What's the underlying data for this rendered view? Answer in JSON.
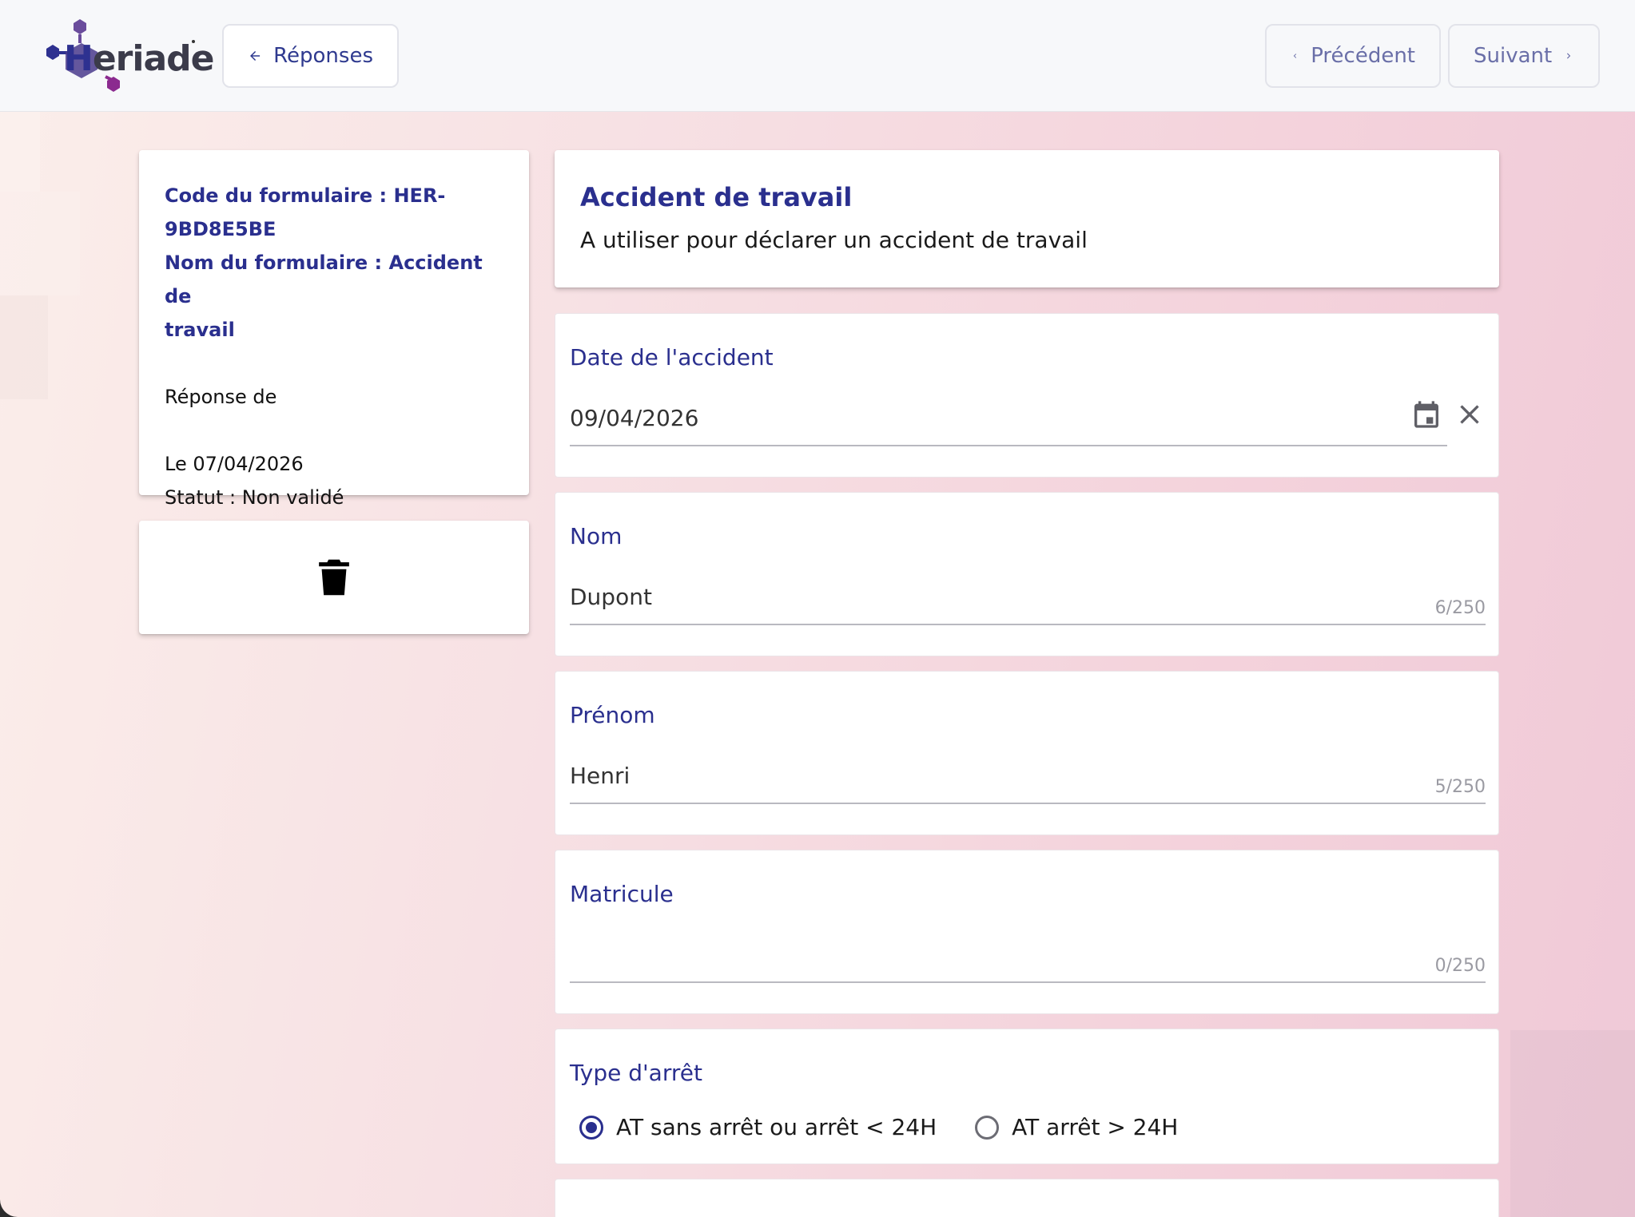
{
  "header": {
    "logo_text_h": "H",
    "logo_text_rest": "eriade",
    "back_label": "Réponses",
    "prev_label": "Précédent",
    "next_label": "Suivant"
  },
  "info": {
    "code_line_1": "Code du formulaire : HER-",
    "code_line_2": "9BD8E5BE",
    "name_line_1": "Nom du formulaire : Accident de",
    "name_line_2": "travail",
    "response_of": "Réponse de",
    "date": "Le 07/04/2026",
    "status": "Statut : Non validé"
  },
  "form": {
    "title": "Accident de travail",
    "description": "A utiliser pour déclarer un accident de travail",
    "fields": [
      {
        "label": "Date de l'accident",
        "value": "09/04/2026"
      },
      {
        "label": "Nom",
        "value": "Dupont",
        "counter": "6/250"
      },
      {
        "label": "Prénom",
        "value": "Henri",
        "counter": "5/250"
      },
      {
        "label": "Matricule",
        "value": "",
        "counter": "0/250"
      }
    ],
    "stop_type": {
      "label": "Type d'arrêt",
      "options": [
        "AT sans arrêt ou arrêt < 24H",
        "AT arrêt > 24H"
      ],
      "selected": 0
    }
  },
  "colors": {
    "brand_blue": "#2a2f8e",
    "brand_purple": "#8b2a8f"
  },
  "icons": [
    "arrow-left-icon",
    "chevron-left-icon",
    "chevron-right-icon",
    "trash-icon",
    "calendar-icon",
    "close-icon"
  ]
}
